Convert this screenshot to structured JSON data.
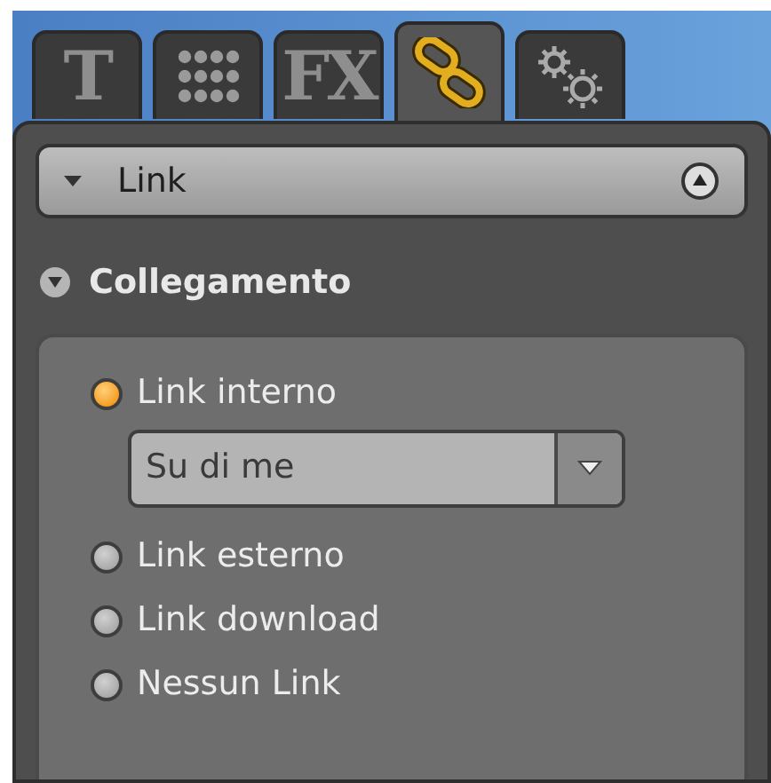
{
  "tabs": [
    {
      "kind": "text",
      "label": "T",
      "selected": false
    },
    {
      "kind": "grid",
      "selected": false
    },
    {
      "kind": "text",
      "label": "FX",
      "selected": false
    },
    {
      "kind": "chain",
      "selected": true
    },
    {
      "kind": "gears",
      "selected": false
    }
  ],
  "header": {
    "title": "Link"
  },
  "section": {
    "title": "Collegamento",
    "expanded": true
  },
  "options": [
    {
      "label": "Link interno",
      "selected": true,
      "dropdown": {
        "value": "Su di me"
      }
    },
    {
      "label": "Link esterno",
      "selected": false
    },
    {
      "label": "Link download",
      "selected": false
    },
    {
      "label": "Nessun Link",
      "selected": false
    }
  ]
}
